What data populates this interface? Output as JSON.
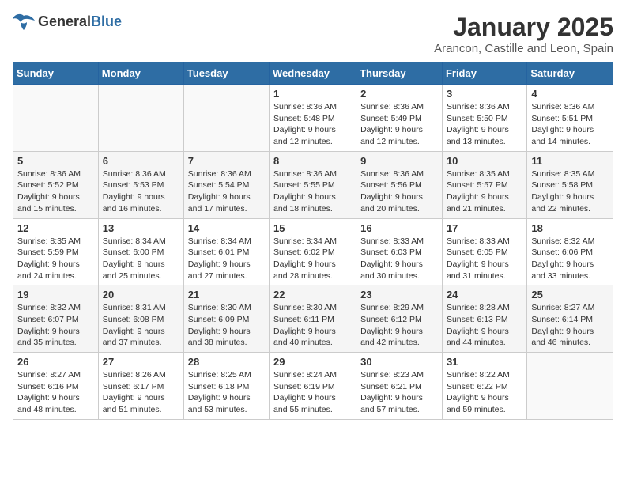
{
  "header": {
    "logo": {
      "general": "General",
      "blue": "Blue"
    },
    "title": "January 2025",
    "location": "Arancon, Castille and Leon, Spain"
  },
  "weekdays": [
    "Sunday",
    "Monday",
    "Tuesday",
    "Wednesday",
    "Thursday",
    "Friday",
    "Saturday"
  ],
  "weeks": [
    [
      {
        "day": "",
        "info": ""
      },
      {
        "day": "",
        "info": ""
      },
      {
        "day": "",
        "info": ""
      },
      {
        "day": "1",
        "sunrise": "Sunrise: 8:36 AM",
        "sunset": "Sunset: 5:48 PM",
        "daylight": "Daylight: 9 hours and 12 minutes."
      },
      {
        "day": "2",
        "sunrise": "Sunrise: 8:36 AM",
        "sunset": "Sunset: 5:49 PM",
        "daylight": "Daylight: 9 hours and 12 minutes."
      },
      {
        "day": "3",
        "sunrise": "Sunrise: 8:36 AM",
        "sunset": "Sunset: 5:50 PM",
        "daylight": "Daylight: 9 hours and 13 minutes."
      },
      {
        "day": "4",
        "sunrise": "Sunrise: 8:36 AM",
        "sunset": "Sunset: 5:51 PM",
        "daylight": "Daylight: 9 hours and 14 minutes."
      }
    ],
    [
      {
        "day": "5",
        "sunrise": "Sunrise: 8:36 AM",
        "sunset": "Sunset: 5:52 PM",
        "daylight": "Daylight: 9 hours and 15 minutes."
      },
      {
        "day": "6",
        "sunrise": "Sunrise: 8:36 AM",
        "sunset": "Sunset: 5:53 PM",
        "daylight": "Daylight: 9 hours and 16 minutes."
      },
      {
        "day": "7",
        "sunrise": "Sunrise: 8:36 AM",
        "sunset": "Sunset: 5:54 PM",
        "daylight": "Daylight: 9 hours and 17 minutes."
      },
      {
        "day": "8",
        "sunrise": "Sunrise: 8:36 AM",
        "sunset": "Sunset: 5:55 PM",
        "daylight": "Daylight: 9 hours and 18 minutes."
      },
      {
        "day": "9",
        "sunrise": "Sunrise: 8:36 AM",
        "sunset": "Sunset: 5:56 PM",
        "daylight": "Daylight: 9 hours and 20 minutes."
      },
      {
        "day": "10",
        "sunrise": "Sunrise: 8:35 AM",
        "sunset": "Sunset: 5:57 PM",
        "daylight": "Daylight: 9 hours and 21 minutes."
      },
      {
        "day": "11",
        "sunrise": "Sunrise: 8:35 AM",
        "sunset": "Sunset: 5:58 PM",
        "daylight": "Daylight: 9 hours and 22 minutes."
      }
    ],
    [
      {
        "day": "12",
        "sunrise": "Sunrise: 8:35 AM",
        "sunset": "Sunset: 5:59 PM",
        "daylight": "Daylight: 9 hours and 24 minutes."
      },
      {
        "day": "13",
        "sunrise": "Sunrise: 8:34 AM",
        "sunset": "Sunset: 6:00 PM",
        "daylight": "Daylight: 9 hours and 25 minutes."
      },
      {
        "day": "14",
        "sunrise": "Sunrise: 8:34 AM",
        "sunset": "Sunset: 6:01 PM",
        "daylight": "Daylight: 9 hours and 27 minutes."
      },
      {
        "day": "15",
        "sunrise": "Sunrise: 8:34 AM",
        "sunset": "Sunset: 6:02 PM",
        "daylight": "Daylight: 9 hours and 28 minutes."
      },
      {
        "day": "16",
        "sunrise": "Sunrise: 8:33 AM",
        "sunset": "Sunset: 6:03 PM",
        "daylight": "Daylight: 9 hours and 30 minutes."
      },
      {
        "day": "17",
        "sunrise": "Sunrise: 8:33 AM",
        "sunset": "Sunset: 6:05 PM",
        "daylight": "Daylight: 9 hours and 31 minutes."
      },
      {
        "day": "18",
        "sunrise": "Sunrise: 8:32 AM",
        "sunset": "Sunset: 6:06 PM",
        "daylight": "Daylight: 9 hours and 33 minutes."
      }
    ],
    [
      {
        "day": "19",
        "sunrise": "Sunrise: 8:32 AM",
        "sunset": "Sunset: 6:07 PM",
        "daylight": "Daylight: 9 hours and 35 minutes."
      },
      {
        "day": "20",
        "sunrise": "Sunrise: 8:31 AM",
        "sunset": "Sunset: 6:08 PM",
        "daylight": "Daylight: 9 hours and 37 minutes."
      },
      {
        "day": "21",
        "sunrise": "Sunrise: 8:30 AM",
        "sunset": "Sunset: 6:09 PM",
        "daylight": "Daylight: 9 hours and 38 minutes."
      },
      {
        "day": "22",
        "sunrise": "Sunrise: 8:30 AM",
        "sunset": "Sunset: 6:11 PM",
        "daylight": "Daylight: 9 hours and 40 minutes."
      },
      {
        "day": "23",
        "sunrise": "Sunrise: 8:29 AM",
        "sunset": "Sunset: 6:12 PM",
        "daylight": "Daylight: 9 hours and 42 minutes."
      },
      {
        "day": "24",
        "sunrise": "Sunrise: 8:28 AM",
        "sunset": "Sunset: 6:13 PM",
        "daylight": "Daylight: 9 hours and 44 minutes."
      },
      {
        "day": "25",
        "sunrise": "Sunrise: 8:27 AM",
        "sunset": "Sunset: 6:14 PM",
        "daylight": "Daylight: 9 hours and 46 minutes."
      }
    ],
    [
      {
        "day": "26",
        "sunrise": "Sunrise: 8:27 AM",
        "sunset": "Sunset: 6:16 PM",
        "daylight": "Daylight: 9 hours and 48 minutes."
      },
      {
        "day": "27",
        "sunrise": "Sunrise: 8:26 AM",
        "sunset": "Sunset: 6:17 PM",
        "daylight": "Daylight: 9 hours and 51 minutes."
      },
      {
        "day": "28",
        "sunrise": "Sunrise: 8:25 AM",
        "sunset": "Sunset: 6:18 PM",
        "daylight": "Daylight: 9 hours and 53 minutes."
      },
      {
        "day": "29",
        "sunrise": "Sunrise: 8:24 AM",
        "sunset": "Sunset: 6:19 PM",
        "daylight": "Daylight: 9 hours and 55 minutes."
      },
      {
        "day": "30",
        "sunrise": "Sunrise: 8:23 AM",
        "sunset": "Sunset: 6:21 PM",
        "daylight": "Daylight: 9 hours and 57 minutes."
      },
      {
        "day": "31",
        "sunrise": "Sunrise: 8:22 AM",
        "sunset": "Sunset: 6:22 PM",
        "daylight": "Daylight: 9 hours and 59 minutes."
      },
      {
        "day": "",
        "info": ""
      }
    ]
  ]
}
